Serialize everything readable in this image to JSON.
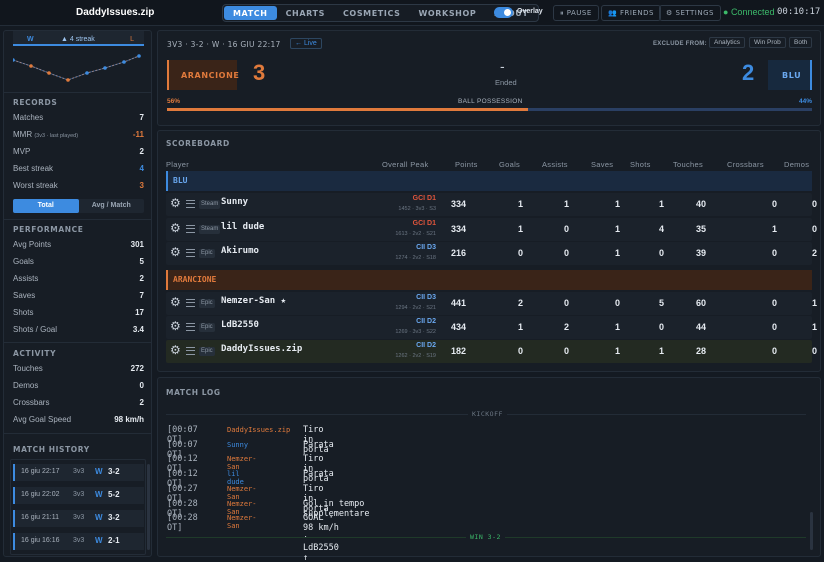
{
  "app": {
    "title": "DaddyIssues.zip"
  },
  "nav": {
    "tabs": [
      "MATCH",
      "CHARTS",
      "COSMETICS",
      "WORKSHOP",
      "ABOUT"
    ],
    "active": "MATCH"
  },
  "overlay": {
    "label": "Overlay",
    "enabled": true
  },
  "toolbar": {
    "pause": "PAUSE",
    "friends": "FRIENDS",
    "settings": "SETTINGS",
    "status": "Connected",
    "timer": "00:10:17"
  },
  "sidebar": {
    "streak_top": {
      "left": "W",
      "center": "▲ 4 streak",
      "right": "L"
    },
    "records_title": "RECORDS",
    "records": [
      {
        "label": "Matches",
        "value": "7"
      },
      {
        "label": "MMR",
        "sub": "(3v3 · last played)",
        "value": "-11",
        "color": "#e07a3c"
      },
      {
        "label": "MVP",
        "value": "2"
      },
      {
        "label": "Best streak",
        "value": "4",
        "color": "#3d8be0"
      },
      {
        "label": "Worst streak",
        "value": "3",
        "color": "#e07a3c"
      }
    ],
    "toggle": {
      "total": "Total",
      "avg": "Avg / Match",
      "active": "Total"
    },
    "performance_title": "PERFORMANCE",
    "performance": [
      {
        "label": "Avg Points",
        "value": "301"
      },
      {
        "label": "Goals",
        "value": "5"
      },
      {
        "label": "Assists",
        "value": "2"
      },
      {
        "label": "Saves",
        "value": "7"
      },
      {
        "label": "Shots",
        "value": "17"
      },
      {
        "label": "Shots / Goal",
        "value": "3.4"
      }
    ],
    "activity_title": "ACTIVITY",
    "activity": [
      {
        "label": "Touches",
        "value": "272"
      },
      {
        "label": "Demos",
        "value": "0"
      },
      {
        "label": "Crossbars",
        "value": "2"
      },
      {
        "label": "Avg Goal Speed",
        "value": "98 km/h"
      }
    ],
    "history_title": "MATCH HISTORY",
    "history": [
      {
        "date": "16 giu 22:17",
        "mode": "3v3",
        "result": "W",
        "score": "3-2"
      },
      {
        "date": "16 giu 22:02",
        "mode": "3v3",
        "result": "W",
        "score": "5-2"
      },
      {
        "date": "16 giu 21:11",
        "mode": "3v3",
        "result": "W",
        "score": "3-2"
      },
      {
        "date": "16 giu 16:16",
        "mode": "3v3",
        "result": "W",
        "score": "2-1"
      }
    ]
  },
  "match": {
    "info": "3V3 · 3-2 · W · 16 GIU 22:17",
    "live": "← Live",
    "exclude_label": "EXCLUDE FROM:",
    "exclude_buttons": [
      "Analytics",
      "Win Prob",
      "Both"
    ],
    "team_orange": {
      "name": "ARANCIONE",
      "score": "3"
    },
    "team_blue": {
      "name": "BLU",
      "score": "2"
    },
    "dash": "-",
    "status": "Ended",
    "possession": {
      "label": "BALL POSSESSION",
      "orange": "56%",
      "blue": "44%",
      "orange_fraction": 0.56
    }
  },
  "scoreboard": {
    "title": "SCOREBOARD",
    "headers": [
      "Player",
      "Overall Peak",
      "Points",
      "Goals",
      "Assists",
      "Saves",
      "Shots",
      "Touches",
      "Crossbars",
      "Demos"
    ],
    "teams": [
      {
        "name": "BLU",
        "color": "#3d8be0",
        "players": [
          {
            "plat": "Steam",
            "name": "Sunny",
            "rank": "GCI D1",
            "rank_color": "#e0553c",
            "sub": "1452 · 3v3 · S3",
            "stats": [
              "334",
              "1",
              "1",
              "1",
              "1",
              "40",
              "0",
              "0"
            ]
          },
          {
            "plat": "Steam",
            "name": "lil dude",
            "rank": "GCI D1",
            "rank_color": "#e0553c",
            "sub": "1613 · 2v2 · S21",
            "stats": [
              "334",
              "1",
              "0",
              "1",
              "4",
              "35",
              "1",
              "0"
            ]
          },
          {
            "plat": "Epic",
            "name": "Akirumo",
            "rank": "CII D3",
            "rank_color": "#6aa8f0",
            "sub": "1274 · 2v2 · S18",
            "stats": [
              "216",
              "0",
              "0",
              "1",
              "0",
              "39",
              "0",
              "2"
            ]
          }
        ]
      },
      {
        "name": "ARANCIONE",
        "color": "#e07a3c",
        "players": [
          {
            "plat": "Epic",
            "name": "Nemzer-San ★",
            "rank": "CII D3",
            "rank_color": "#6aa8f0",
            "sub": "1294 · 2v2 · S21",
            "stats": [
              "441",
              "2",
              "0",
              "0",
              "5",
              "60",
              "0",
              "1"
            ]
          },
          {
            "plat": "Epic",
            "name": "LdB2550",
            "rank": "CII D2",
            "rank_color": "#6aa8f0",
            "sub": "1269 · 3v3 · S22",
            "stats": [
              "434",
              "1",
              "2",
              "1",
              "0",
              "44",
              "0",
              "1"
            ]
          },
          {
            "plat": "Epic",
            "name": "DaddyIssues.zip",
            "rank": "CII D2",
            "rank_color": "#6aa8f0",
            "sub": "1262 · 2v2 · S19",
            "stats": [
              "182",
              "0",
              "0",
              "1",
              "1",
              "28",
              "0",
              "0"
            ],
            "is_self": true
          }
        ]
      }
    ]
  },
  "log": {
    "title": "MATCH LOG",
    "kickoff": "KICKOFF",
    "end": "WIN 3-2",
    "entries": [
      {
        "time": "[00:07 OT]",
        "who": "DaddyIssues.zip",
        "color": "#e07a3c",
        "event": "Tiro in porta"
      },
      {
        "time": "[00:07 OT]",
        "who": "Sunny",
        "color": "#3d8be0",
        "event": "Parata"
      },
      {
        "time": "[00:12 OT]",
        "who": "Nemzer-San",
        "color": "#e07a3c",
        "event": "Tiro in porta"
      },
      {
        "time": "[00:12 OT]",
        "who": "lil dude",
        "color": "#3d8be0",
        "event": "Parata"
      },
      {
        "time": "[00:27 OT]",
        "who": "Nemzer-San",
        "color": "#e07a3c",
        "event": "Tiro in porta"
      },
      {
        "time": "[00:28 OT]",
        "who": "Nemzer-San",
        "color": "#e07a3c",
        "event": "Gol in tempo supplementare"
      },
      {
        "time": "[00:28 OT]",
        "who": "Nemzer-San",
        "color": "#e07a3c",
        "event": "GOAL · 98 km/h · LdB2550 ↑"
      }
    ]
  },
  "colors": {
    "blue": "#3d8be0",
    "orange": "#e07a3c",
    "green": "#3cba6a"
  }
}
